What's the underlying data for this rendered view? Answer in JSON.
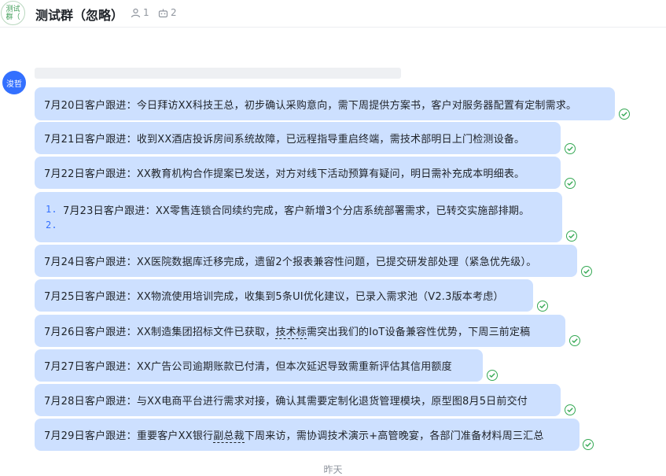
{
  "header": {
    "avatar_text": "测试群（",
    "title": "测试群（忽略）",
    "member_count": "1",
    "bot_count": "2"
  },
  "sender": {
    "avatar_text": "浚哲"
  },
  "messages": [
    "7月20日客户跟进：今日拜访XX科技王总，初步确认采购意向，需下周提供方案书，客户对服务器配置有定制需求。",
    "7月21日客户跟进：收到XX酒店投诉房间系统故障，已远程指导重启终端，需技术部明日上门检测设备。",
    "7月22日客户跟进：XX教育机构合作提案已发送，对方对线下活动预算有疑问，明日需补充成本明细表。",
    "7月24日客户跟进：XX医院数据库迁移完成，遗留2个报表兼容性问题，已提交研发部处理（紧急优先级）。",
    "7月25日客户跟进：XX物流使用培训完成，收集到5条UI优化建议，已录入需求池（V2.3版本考虑）",
    "7月27日客户跟进：XX广告公司逾期账款已付清，但本次延迟导致需重新评估其信用额度",
    "7月28日客户跟进：与XX电商平台进行需求对接，确认其需要定制化退货管理模块，原型图8月5日前交付"
  ],
  "list_message": {
    "num1": "1.",
    "item1": "7月23日客户跟进：XX零售连锁合同续约完成，客户新增3个分店系统部署需求，已转交实施部排期。",
    "num2": "2."
  },
  "msg26": {
    "a": "7月26日客户跟进：XX制造集团招标文件已获取，",
    "b": "技术标",
    "c": "需突出我们的IoT设备兼容性优势，下周三前定稿"
  },
  "msg29": {
    "a": "7月29日客户跟进：重要客户XX银行",
    "b": "副总裁",
    "c": "下周来访，需协调技术演示+高管晚宴，各部门准备材料周三汇总"
  },
  "date_separator": "昨天",
  "colors": {
    "bubble": "#cde0ff",
    "accent": "#3370ff",
    "read_check": "#34a853"
  }
}
